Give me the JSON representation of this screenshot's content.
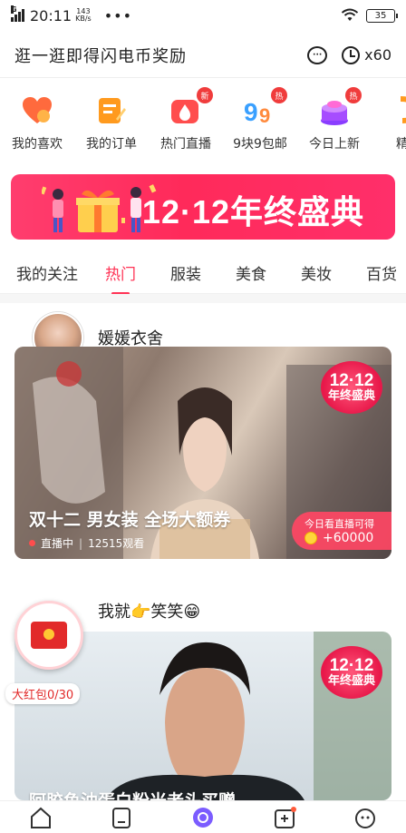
{
  "status": {
    "carrier_badge": "G",
    "time": "20:11",
    "speed_value": "143",
    "speed_unit": "KB/s",
    "more": "•••",
    "battery": "35"
  },
  "header": {
    "title": "逛一逛即得闪电币奖励",
    "coin_count": "x60"
  },
  "quick_links": [
    {
      "label": "我的喜欢",
      "icon": "heart-icon",
      "badge": "",
      "color": "#ff6a3d"
    },
    {
      "label": "我的订单",
      "icon": "order-icon",
      "badge": "",
      "color": "#ff9a1e"
    },
    {
      "label": "热门直播",
      "icon": "live-icon",
      "badge": "新",
      "color": "#ff4d4d"
    },
    {
      "label": "9块9包邮",
      "icon": "nine-icon",
      "badge": "热",
      "color": "#3aa0ff"
    },
    {
      "label": "今日上新",
      "icon": "cake-icon",
      "badge": "热",
      "color": "#a64dff"
    },
    {
      "label": "精选",
      "icon": "pick-icon",
      "badge": "",
      "color": "#ff9a1e"
    }
  ],
  "banner": {
    "text": "12·12年终盛典"
  },
  "tabs": [
    "我的关注",
    "热门",
    "服装",
    "美食",
    "美妆",
    "百货"
  ],
  "active_tab": 1,
  "feed": [
    {
      "name": "媛媛衣舍",
      "caption": "双十二 男女装 全场大额券",
      "status": "直播中",
      "viewers": "12515观看",
      "reward_title": "今日看直播可得",
      "reward_amount": "+60000",
      "stamp_top": "12·12",
      "stamp_bottom": "年终盛典"
    },
    {
      "name": "我就👉笑笑😁",
      "caption": "阿胶鱼油蛋白粉米老头买赠",
      "stamp_top": "12·12",
      "stamp_bottom": "年终盛典"
    }
  ],
  "red_packet": {
    "label": "大红包0/30"
  }
}
